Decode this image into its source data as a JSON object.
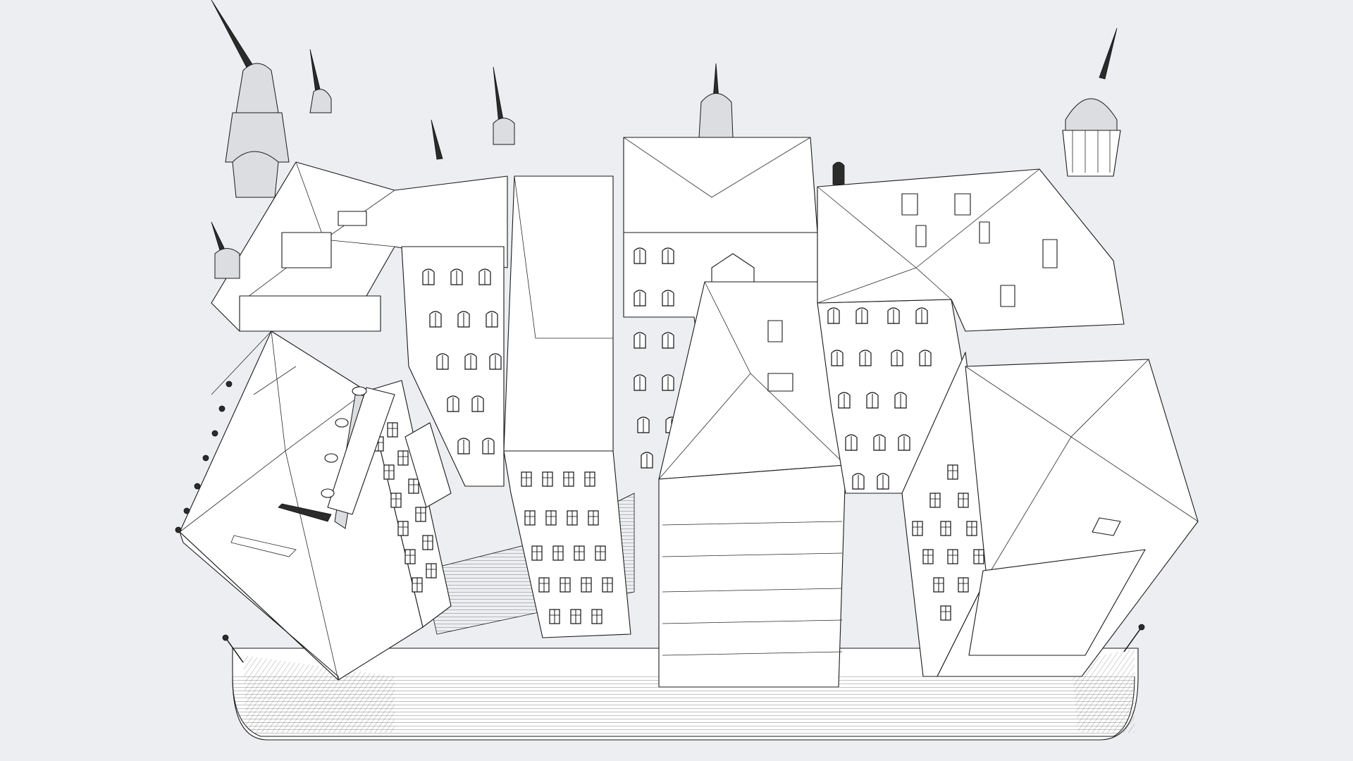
{
  "canvas": {
    "background": "#eceef1",
    "line_color": "#1a1a1a",
    "fill_color": "#ffffff"
  },
  "model": {
    "view": "aerial-isometric",
    "render_style": "wireframe-line-drawing"
  }
}
